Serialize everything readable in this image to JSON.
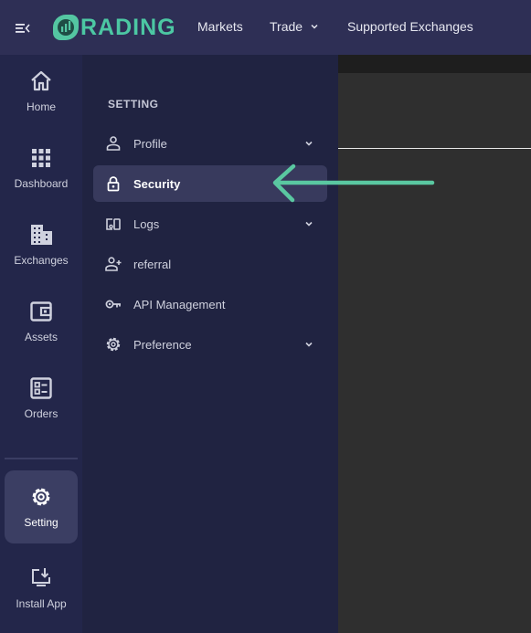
{
  "topbar": {
    "logo_text": "RADING",
    "nav": [
      {
        "label": "Markets"
      },
      {
        "label": "Trade",
        "has_dropdown": true
      },
      {
        "label": "Supported Exchanges"
      }
    ]
  },
  "rail": {
    "items": [
      {
        "label": "Home",
        "icon": "home-icon"
      },
      {
        "label": "Dashboard",
        "icon": "grid-icon"
      },
      {
        "label": "Exchanges",
        "icon": "building-icon"
      },
      {
        "label": "Assets",
        "icon": "wallet-icon"
      },
      {
        "label": "Orders",
        "icon": "orders-icon"
      },
      {
        "label": "Setting",
        "icon": "gear-icon",
        "active": true
      },
      {
        "label": "Install App",
        "icon": "install-icon"
      }
    ]
  },
  "panel": {
    "heading": "SETTING",
    "items": [
      {
        "label": "Profile",
        "icon": "user-icon",
        "expandable": true
      },
      {
        "label": "Security",
        "icon": "lock-icon",
        "active": true
      },
      {
        "label": "Logs",
        "icon": "devices-icon",
        "expandable": true
      },
      {
        "label": "referral",
        "icon": "user-plus-icon"
      },
      {
        "label": "API Management",
        "icon": "key-icon"
      },
      {
        "label": "Preference",
        "icon": "gear-icon",
        "expandable": true
      }
    ]
  },
  "colors": {
    "accent": "#4cc7a3",
    "topbar": "#2e2f55",
    "rail": "#23264a",
    "panel": "#202341",
    "active_item": "#383a5d",
    "content": "#2f2f2f"
  }
}
